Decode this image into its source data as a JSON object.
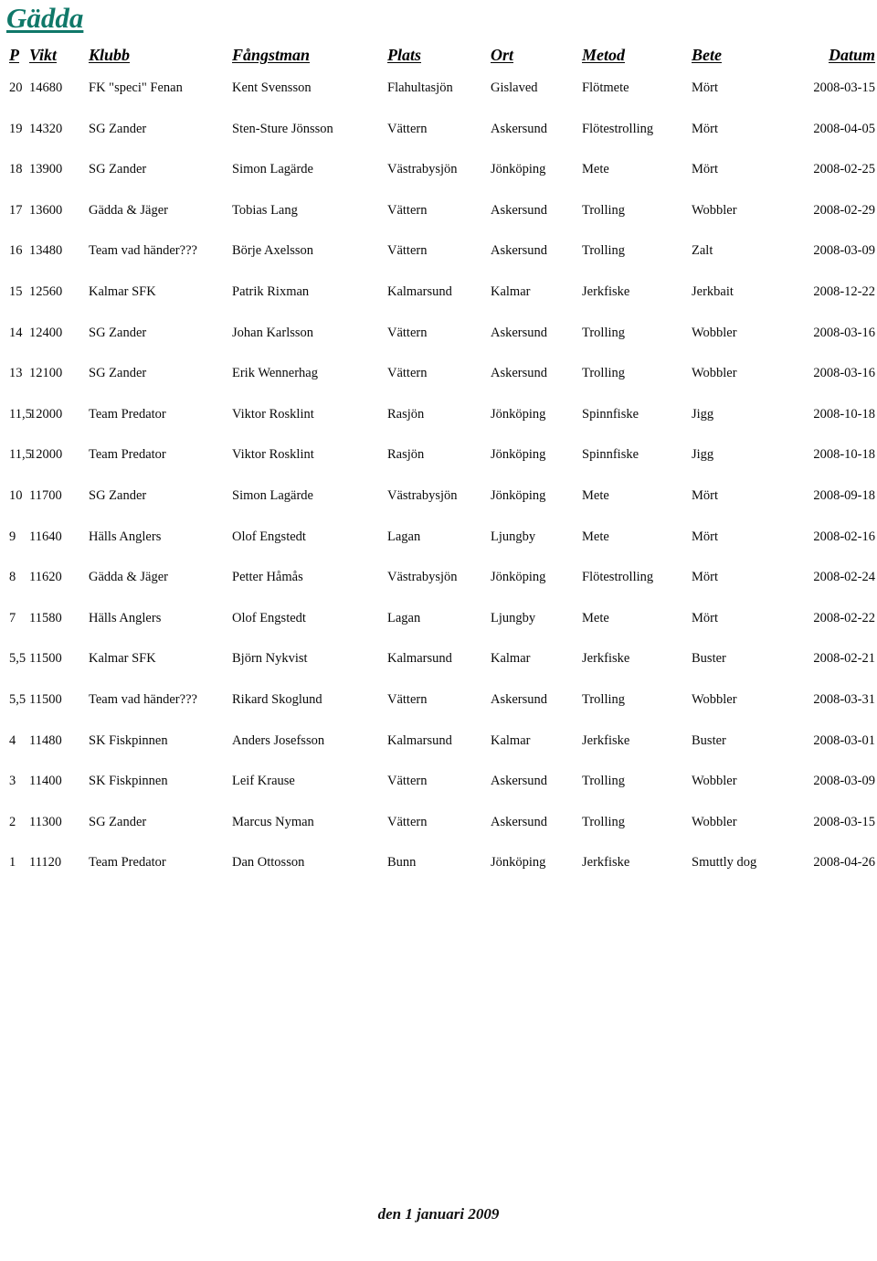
{
  "document": {
    "title": "Gädda",
    "title_color": "#107869",
    "footer": "den 1 januari 2009"
  },
  "table": {
    "columns": [
      {
        "key": "p",
        "label": "P"
      },
      {
        "key": "vikt",
        "label": "Vikt"
      },
      {
        "key": "klubb",
        "label": "Klubb"
      },
      {
        "key": "fangstman",
        "label": "Fångstman"
      },
      {
        "key": "plats",
        "label": "Plats"
      },
      {
        "key": "ort",
        "label": "Ort"
      },
      {
        "key": "metod",
        "label": "Metod"
      },
      {
        "key": "bete",
        "label": "Bete"
      },
      {
        "key": "datum",
        "label": "Datum"
      }
    ],
    "rows": [
      {
        "p": "20",
        "vikt": "14680",
        "klubb": "FK \"speci\" Fenan",
        "fangstman": "Kent Svensson",
        "plats": "Flahultasjön",
        "ort": "Gislaved",
        "metod": "Flötmete",
        "bete": "Mört",
        "datum": "2008-03-15"
      },
      {
        "p": "19",
        "vikt": "14320",
        "klubb": "SG Zander",
        "fangstman": "Sten-Sture Jönsson",
        "plats": "Vättern",
        "ort": "Askersund",
        "metod": "Flötestrolling",
        "bete": "Mört",
        "datum": "2008-04-05"
      },
      {
        "p": "18",
        "vikt": "13900",
        "klubb": "SG Zander",
        "fangstman": "Simon Lagärde",
        "plats": "Västrabysjön",
        "ort": "Jönköping",
        "metod": "Mete",
        "bete": "Mört",
        "datum": "2008-02-25"
      },
      {
        "p": "17",
        "vikt": "13600",
        "klubb": "Gädda & Jäger",
        "fangstman": "Tobias Lang",
        "plats": "Vättern",
        "ort": "Askersund",
        "metod": "Trolling",
        "bete": "Wobbler",
        "datum": "2008-02-29"
      },
      {
        "p": "16",
        "vikt": "13480",
        "klubb": "Team vad händer???",
        "fangstman": "Börje Axelsson",
        "plats": "Vättern",
        "ort": "Askersund",
        "metod": "Trolling",
        "bete": "Zalt",
        "datum": "2008-03-09"
      },
      {
        "p": "15",
        "vikt": "12560",
        "klubb": "Kalmar SFK",
        "fangstman": "Patrik Rixman",
        "plats": "Kalmarsund",
        "ort": "Kalmar",
        "metod": "Jerkfiske",
        "bete": "Jerkbait",
        "datum": "2008-12-22"
      },
      {
        "p": "14",
        "vikt": "12400",
        "klubb": "SG Zander",
        "fangstman": "Johan Karlsson",
        "plats": "Vättern",
        "ort": "Askersund",
        "metod": "Trolling",
        "bete": "Wobbler",
        "datum": "2008-03-16"
      },
      {
        "p": "13",
        "vikt": "12100",
        "klubb": "SG Zander",
        "fangstman": "Erik Wennerhag",
        "plats": "Vättern",
        "ort": "Askersund",
        "metod": "Trolling",
        "bete": "Wobbler",
        "datum": "2008-03-16"
      },
      {
        "p": "11,5",
        "vikt": "12000",
        "klubb": "Team Predator",
        "fangstman": "Viktor Rosklint",
        "plats": "Rasjön",
        "ort": "Jönköping",
        "metod": "Spinnfiske",
        "bete": "Jigg",
        "datum": "2008-10-18"
      },
      {
        "p": "11,5",
        "vikt": "12000",
        "klubb": "Team Predator",
        "fangstman": "Viktor Rosklint",
        "plats": "Rasjön",
        "ort": "Jönköping",
        "metod": "Spinnfiske",
        "bete": "Jigg",
        "datum": "2008-10-18"
      },
      {
        "p": "10",
        "vikt": "11700",
        "klubb": "SG Zander",
        "fangstman": "Simon Lagärde",
        "plats": "Västrabysjön",
        "ort": "Jönköping",
        "metod": "Mete",
        "bete": "Mört",
        "datum": "2008-09-18"
      },
      {
        "p": "9",
        "vikt": "11640",
        "klubb": "Hälls Anglers",
        "fangstman": "Olof Engstedt",
        "plats": "Lagan",
        "ort": "Ljungby",
        "metod": "Mete",
        "bete": "Mört",
        "datum": "2008-02-16"
      },
      {
        "p": "8",
        "vikt": "11620",
        "klubb": "Gädda & Jäger",
        "fangstman": "Petter Håmås",
        "plats": "Västrabysjön",
        "ort": "Jönköping",
        "metod": "Flötestrolling",
        "bete": "Mört",
        "datum": "2008-02-24"
      },
      {
        "p": "7",
        "vikt": "11580",
        "klubb": "Hälls Anglers",
        "fangstman": "Olof Engstedt",
        "plats": "Lagan",
        "ort": "Ljungby",
        "metod": "Mete",
        "bete": "Mört",
        "datum": "2008-02-22"
      },
      {
        "p": "5,5",
        "vikt": "11500",
        "klubb": "Kalmar SFK",
        "fangstman": "Björn Nykvist",
        "plats": "Kalmarsund",
        "ort": "Kalmar",
        "metod": "Jerkfiske",
        "bete": "Buster",
        "datum": "2008-02-21"
      },
      {
        "p": "5,5",
        "vikt": "11500",
        "klubb": "Team vad händer???",
        "fangstman": "Rikard Skoglund",
        "plats": "Vättern",
        "ort": "Askersund",
        "metod": "Trolling",
        "bete": "Wobbler",
        "datum": "2008-03-31"
      },
      {
        "p": "4",
        "vikt": "11480",
        "klubb": "SK Fiskpinnen",
        "fangstman": "Anders Josefsson",
        "plats": "Kalmarsund",
        "ort": "Kalmar",
        "metod": "Jerkfiske",
        "bete": "Buster",
        "datum": "2008-03-01"
      },
      {
        "p": "3",
        "vikt": "11400",
        "klubb": "SK Fiskpinnen",
        "fangstman": "Leif Krause",
        "plats": "Vättern",
        "ort": "Askersund",
        "metod": "Trolling",
        "bete": "Wobbler",
        "datum": "2008-03-09"
      },
      {
        "p": "2",
        "vikt": "11300",
        "klubb": "SG Zander",
        "fangstman": "Marcus Nyman",
        "plats": "Vättern",
        "ort": "Askersund",
        "metod": "Trolling",
        "bete": "Wobbler",
        "datum": "2008-03-15"
      },
      {
        "p": "1",
        "vikt": "11120",
        "klubb": "Team Predator",
        "fangstman": "Dan Ottosson",
        "plats": "Bunn",
        "ort": "Jönköping",
        "metod": "Jerkfiske",
        "bete": "Smuttly dog",
        "datum": "2008-04-26"
      }
    ]
  }
}
